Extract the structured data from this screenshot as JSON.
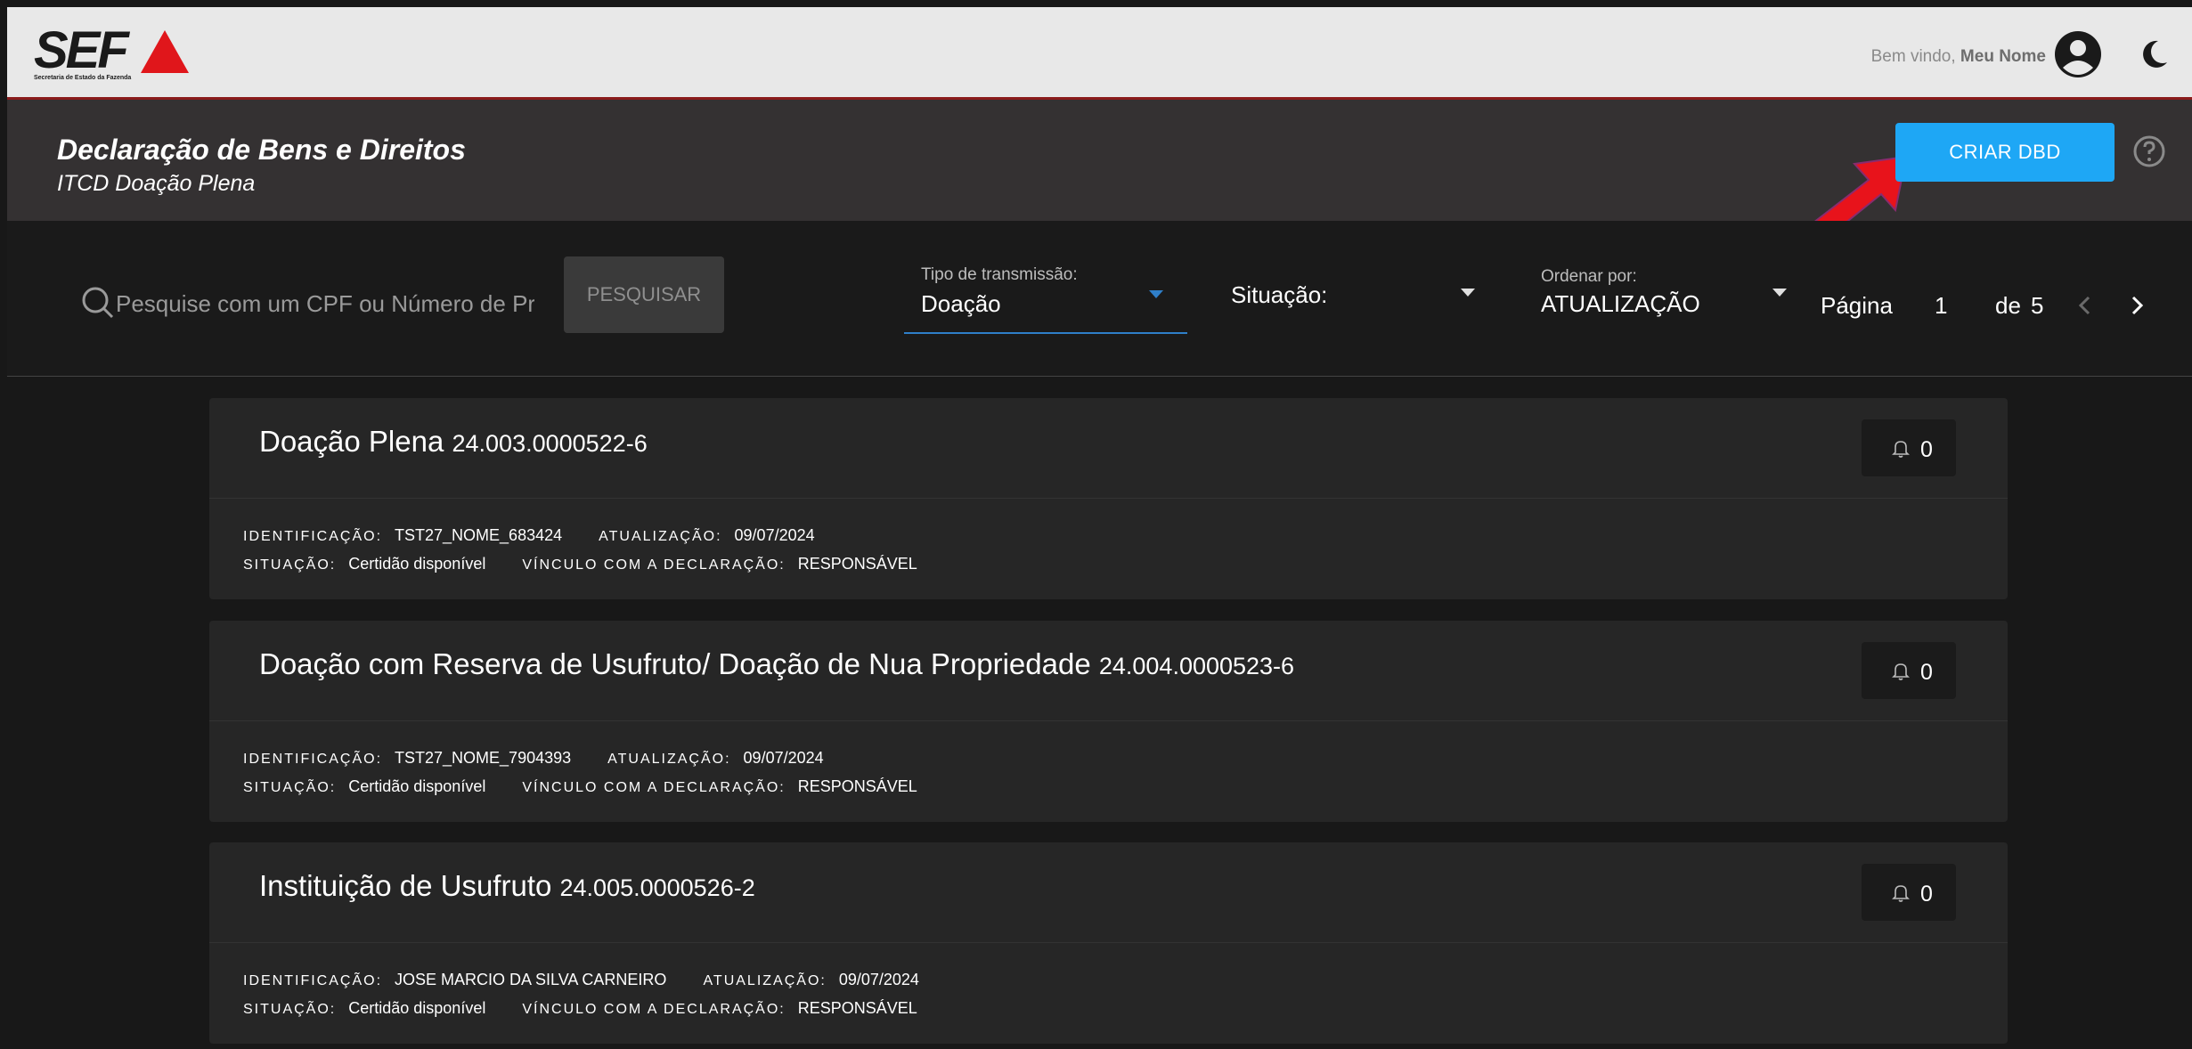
{
  "brand": {
    "logo_text": "SEF",
    "logo_subtitle": "Secretaria de Estado da Fazenda",
    "accent_color": "#e0161b"
  },
  "user": {
    "welcome_prefix": "Bem vindo,",
    "name": "Meu Nome"
  },
  "header": {
    "title": "Declaração de Bens e Direitos",
    "subtitle": "ITCD Doação Plena",
    "create_button": "CRIAR DBD",
    "button_color": "#1ea7f5"
  },
  "filters": {
    "search_placeholder": "Pesquise com um CPF ou Número de Protocolo",
    "search_button": "PESQUISAR",
    "tipo_label": "Tipo de transmissão:",
    "tipo_value": "Doação",
    "situacao_label": "Situação:",
    "ordenar_label": "Ordenar por:",
    "ordenar_value": "ATUALIZAÇÃO",
    "pagina_label": "Página",
    "pagina_value": "1",
    "de_label": "de",
    "total_pages": "5"
  },
  "labels": {
    "identificacao": "IDENTIFICAÇÃO:",
    "atualizacao": "ATUALIZAÇÃO:",
    "situacao": "SITUAÇÃO:",
    "vinculo": "VÍNCULO COM A DECLARAÇÃO:"
  },
  "cards": [
    {
      "title": "Doação Plena",
      "code": "24.003.0000522-6",
      "notifications": "0",
      "identificacao": "TST27_NOME_683424",
      "atualizacao": "09/07/2024",
      "situacao": "Certidão disponível",
      "vinculo": "RESPONSÁVEL"
    },
    {
      "title": "Doação com Reserva de Usufruto/ Doação de Nua Propriedade",
      "code": "24.004.0000523-6",
      "notifications": "0",
      "identificacao": "TST27_NOME_7904393",
      "atualizacao": "09/07/2024",
      "situacao": "Certidão disponível",
      "vinculo": "RESPONSÁVEL"
    },
    {
      "title": "Instituição de Usufruto",
      "code": "24.005.0000526-2",
      "notifications": "0",
      "identificacao": "JOSE MARCIO DA SILVA CARNEIRO",
      "atualizacao": "09/07/2024",
      "situacao": "Certidão disponível",
      "vinculo": "RESPONSÁVEL"
    }
  ]
}
